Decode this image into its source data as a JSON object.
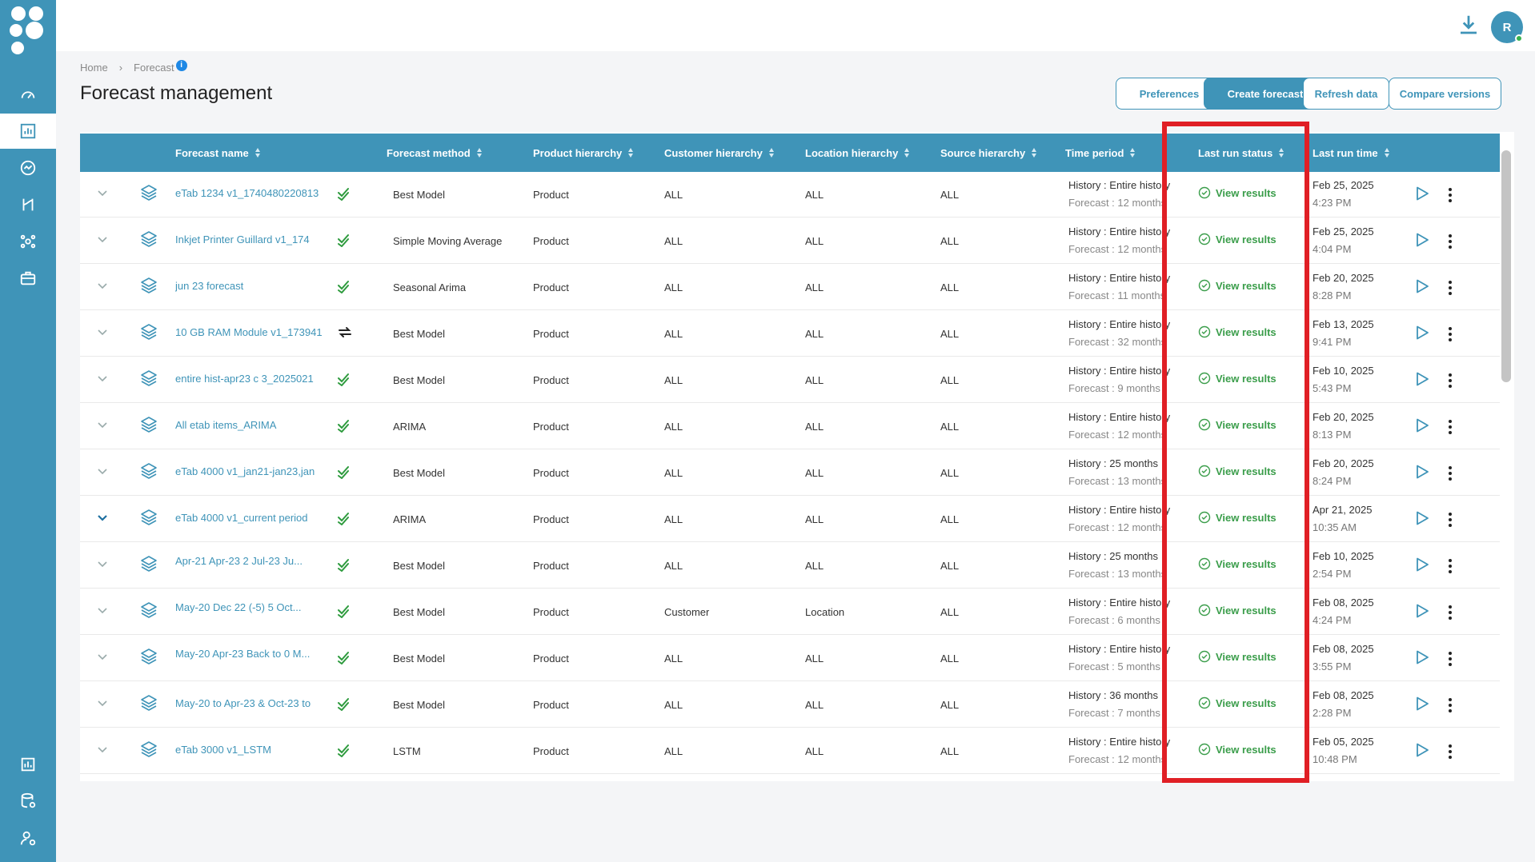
{
  "nav": {
    "icons": [
      "dashboard-icon",
      "forecast-chart-icon",
      "analytics-icon",
      "planning-icon",
      "network-icon",
      "briefcase-icon",
      "reports-icon",
      "data-settings-icon",
      "user-settings-icon"
    ]
  },
  "user": {
    "initial": "R"
  },
  "breadcrumb": {
    "home": "Home",
    "current": "Forecast",
    "info": "i"
  },
  "page": {
    "title": "Forecast management"
  },
  "buttons": {
    "preferences": "Preferences",
    "create": "Create forecast",
    "refresh": "Refresh data",
    "compare": "Compare versions"
  },
  "table": {
    "headers": {
      "name": "Forecast name",
      "method": "Forecast method",
      "product": "Product hierarchy",
      "customer": "Customer hierarchy",
      "location": "Location hierarchy",
      "source": "Source hierarchy",
      "period": "Time period",
      "status": "Last run status",
      "time": "Last run time"
    },
    "rows": [
      {
        "name": "eTab 1234 v1_1740480220813",
        "two_line": false,
        "status_icon": "check-icon",
        "method": "Best Model",
        "product": "Product",
        "customer": "ALL",
        "location": "ALL",
        "source": "ALL",
        "history": "History : Entire history",
        "forecast": "Forecast : 12 months",
        "status": "View results",
        "date": "Feb 25, 2025",
        "time": "4:23 PM",
        "expanded": false
      },
      {
        "name": "Inkjet Printer Guillard v1_174",
        "two_line": false,
        "status_icon": "check-icon",
        "method": "Simple Moving Average",
        "product": "Product",
        "customer": "ALL",
        "location": "ALL",
        "source": "ALL",
        "history": "History : Entire history",
        "forecast": "Forecast : 12 months",
        "status": "View results",
        "date": "Feb 25, 2025",
        "time": "4:04 PM",
        "expanded": false
      },
      {
        "name": "jun 23 forecast",
        "two_line": false,
        "status_icon": "check-icon",
        "method": "Seasonal Arima",
        "product": "Product",
        "customer": "ALL",
        "location": "ALL",
        "source": "ALL",
        "history": "History : Entire history",
        "forecast": "Forecast : 11 months",
        "status": "View results",
        "date": "Feb 20, 2025",
        "time": "8:28 PM",
        "expanded": false
      },
      {
        "name": "10 GB RAM Module v1_173941",
        "two_line": false,
        "status_icon": "sync-icon",
        "method": "Best Model",
        "product": "Product",
        "customer": "ALL",
        "location": "ALL",
        "source": "ALL",
        "history": "History : Entire history",
        "forecast": "Forecast : 32 months",
        "status": "View results",
        "date": "Feb 13, 2025",
        "time": "9:41 PM",
        "expanded": false
      },
      {
        "name": "entire hist-apr23 c 3_2025021",
        "two_line": false,
        "status_icon": "check-icon",
        "method": "Best Model",
        "product": "Product",
        "customer": "ALL",
        "location": "ALL",
        "source": "ALL",
        "history": "History : Entire history",
        "forecast": "Forecast : 9 months",
        "status": "View results",
        "date": "Feb 10, 2025",
        "time": "5:43 PM",
        "expanded": false
      },
      {
        "name": "All etab items_ARIMA",
        "two_line": false,
        "status_icon": "check-icon",
        "method": "ARIMA",
        "product": "Product",
        "customer": "ALL",
        "location": "ALL",
        "source": "ALL",
        "history": "History : Entire history",
        "forecast": "Forecast : 12 months",
        "status": "View results",
        "date": "Feb 20, 2025",
        "time": "8:13 PM",
        "expanded": false
      },
      {
        "name": "eTab 4000 v1_jan21-jan23,jan",
        "two_line": false,
        "status_icon": "check-icon",
        "method": "Best Model",
        "product": "Product",
        "customer": "ALL",
        "location": "ALL",
        "source": "ALL",
        "history": "History : 25 months",
        "forecast": "Forecast : 13 months",
        "status": "View results",
        "date": "Feb 20, 2025",
        "time": "8:24 PM",
        "expanded": false
      },
      {
        "name": "eTab 4000 v1_current period",
        "two_line": false,
        "status_icon": "check-icon",
        "method": "ARIMA",
        "product": "Product",
        "customer": "ALL",
        "location": "ALL",
        "source": "ALL",
        "history": "History : Entire history",
        "forecast": "Forecast : 12 months",
        "status": "View results",
        "date": "Apr 21, 2025",
        "time": "10:35 AM",
        "expanded": true
      },
      {
        "name": "Apr-21    Apr-23    2    Jul-23    Ju...",
        "two_line": true,
        "status_icon": "check-icon",
        "method": "Best Model",
        "product": "Product",
        "customer": "ALL",
        "location": "ALL",
        "source": "ALL",
        "history": "History : 25 months",
        "forecast": "Forecast : 13 months",
        "status": "View results",
        "date": "Feb 10, 2025",
        "time": "2:54 PM",
        "expanded": false
      },
      {
        "name": "May-20    Dec 22 (-5)    5    Oct...",
        "two_line": true,
        "status_icon": "check-icon",
        "method": "Best Model",
        "product": "Product",
        "customer": "Customer",
        "location": "Location",
        "source": "ALL",
        "history": "History : Entire history",
        "forecast": "Forecast : 6 months",
        "status": "View results",
        "date": "Feb 08, 2025",
        "time": "4:24 PM",
        "expanded": false
      },
      {
        "name": "May-20    Apr-23    Back to 0    M...",
        "two_line": true,
        "status_icon": "check-icon",
        "method": "Best Model",
        "product": "Product",
        "customer": "ALL",
        "location": "ALL",
        "source": "ALL",
        "history": "History : Entire history",
        "forecast": "Forecast : 5 months",
        "status": "View results",
        "date": "Feb 08, 2025",
        "time": "3:55 PM",
        "expanded": false
      },
      {
        "name": "May-20 to Apr-23 & Oct-23 to",
        "two_line": false,
        "status_icon": "check-icon",
        "method": "Best Model",
        "product": "Product",
        "customer": "ALL",
        "location": "ALL",
        "source": "ALL",
        "history": "History : 36 months",
        "forecast": "Forecast : 7 months",
        "status": "View results",
        "date": "Feb 08, 2025",
        "time": "2:28 PM",
        "expanded": false
      },
      {
        "name": "eTab 3000 v1_LSTM",
        "two_line": false,
        "status_icon": "check-icon",
        "method": "LSTM",
        "product": "Product",
        "customer": "ALL",
        "location": "ALL",
        "source": "ALL",
        "history": "History : Entire history",
        "forecast": "Forecast : 12 months",
        "status": "View results",
        "date": "Feb 05, 2025",
        "time": "10:48 PM",
        "expanded": false
      }
    ]
  },
  "colors": {
    "accent": "#3f94b8",
    "success": "#3a9d4a",
    "highlight": "#e01f25"
  }
}
